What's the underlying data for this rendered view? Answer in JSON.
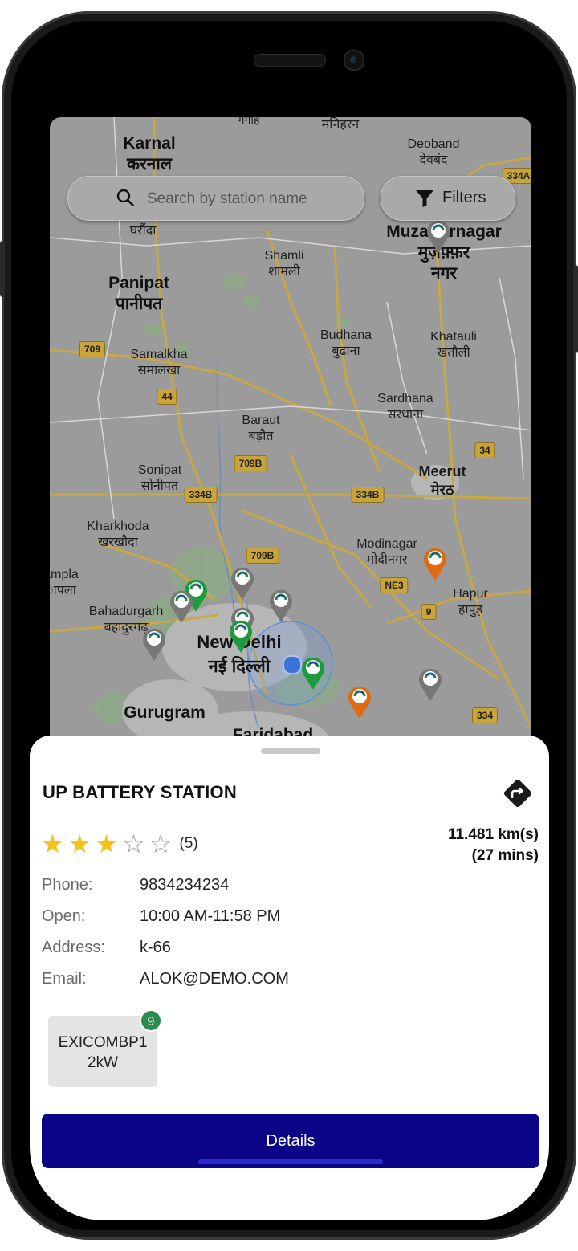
{
  "search": {
    "placeholder": "Search by station name"
  },
  "filters": {
    "label": "Filters"
  },
  "map": {
    "cities": [
      {
        "id": "karnal",
        "en": "Karnal",
        "hi": "करनाल"
      },
      {
        "id": "panipat",
        "en": "Panipat",
        "hi": "पानीपत"
      },
      {
        "id": "samalkha",
        "en": "Samalkha",
        "hi": "समालखा"
      },
      {
        "id": "shamli",
        "en": "Shamli",
        "hi": "शामली"
      },
      {
        "id": "budhana",
        "en": "Budhana",
        "hi": "बुढाना"
      },
      {
        "id": "khatauli",
        "en": "Khatauli",
        "hi": "खतौली"
      },
      {
        "id": "muzaffarnagar",
        "en": "Muzaffarnagar",
        "hi": "मुज़फ़्फ़र नगर"
      },
      {
        "id": "deoband",
        "en": "Deoband",
        "hi": "देवबंद"
      },
      {
        "id": "sardhana",
        "en": "Sardhana",
        "hi": "सरधाना"
      },
      {
        "id": "baraut",
        "en": "Baraut",
        "hi": "बड़ौत"
      },
      {
        "id": "sonipat",
        "en": "Sonipat",
        "hi": "सोनीपत"
      },
      {
        "id": "meerut",
        "en": "Meerut",
        "hi": "मेरठ"
      },
      {
        "id": "kharkhoda",
        "en": "Kharkhoda",
        "hi": "खरखौदा"
      },
      {
        "id": "modinagar",
        "en": "Modinagar",
        "hi": "मोदीनगर"
      },
      {
        "id": "hapur",
        "en": "Hapur",
        "hi": "हापुड़"
      },
      {
        "id": "bahadurgarh",
        "en": "Bahadurgarh",
        "hi": "बहादुरगढ़"
      },
      {
        "id": "newdelhi",
        "en": "New Delhi",
        "hi": "नई दिल्ली"
      },
      {
        "id": "gurugram",
        "en": "Gurugram",
        "hi": ""
      },
      {
        "id": "faridabad",
        "en": "Faridabad",
        "hi": ""
      },
      {
        "id": "gharaunda",
        "en": "",
        "hi": "घरौंदा"
      },
      {
        "id": "manihran",
        "en": "",
        "hi": "मनिहरन"
      },
      {
        "id": "gangoh",
        "en": "",
        "hi": "गंगोह"
      },
      {
        "id": "jhajjar",
        "en": "ampla",
        "hi": "ापला"
      }
    ],
    "highways": [
      "709",
      "44",
      "709B",
      "334B",
      "334B",
      "709B",
      "NE3",
      "9",
      "34",
      "334A",
      "334"
    ]
  },
  "station": {
    "name": "UP BATTERY STATION",
    "rating": 3,
    "rating_max": 5,
    "rating_count": "(5)",
    "distance": "11.481 km(s)",
    "duration": "(27 mins)",
    "phone_label": "Phone:",
    "phone": "9834234234",
    "open_label": "Open:",
    "open": "10:00 AM-11:58 PM",
    "address_label": "Address:",
    "address": "k-66",
    "email_label": "Email:",
    "email": "ALOK@DEMO.COM"
  },
  "connector": {
    "name": "EXICOMBP1",
    "power": "2kW",
    "count": "9"
  },
  "details_button": "Details",
  "colors": {
    "primary": "#0b0486",
    "badge": "#2e8b4e",
    "star": "#f2c31a",
    "pin_green": "#1f9a3e",
    "pin_gray": "#777777",
    "pin_orange": "#e06a10"
  }
}
